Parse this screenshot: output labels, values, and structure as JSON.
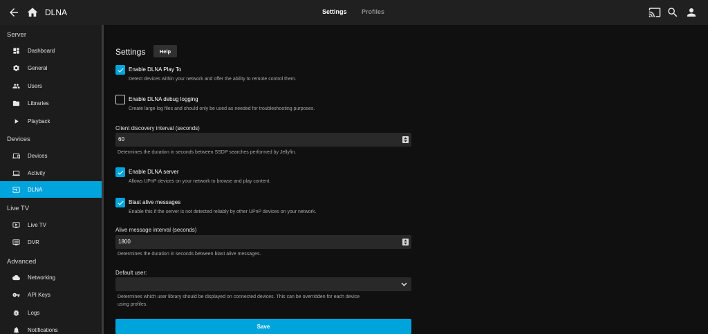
{
  "header": {
    "title": "DLNA",
    "tabs": [
      "Settings",
      "Profiles"
    ],
    "icons": [
      "back-arrow-icon",
      "home-icon",
      "cast-icon",
      "search-icon",
      "user-icon"
    ]
  },
  "sidebar": {
    "sections": [
      {
        "title": "Server",
        "items": [
          {
            "label": "Dashboard",
            "icon": "dashboard-icon"
          },
          {
            "label": "General",
            "icon": "gear-icon"
          },
          {
            "label": "Users",
            "icon": "users-icon"
          },
          {
            "label": "Libraries",
            "icon": "folder-icon"
          },
          {
            "label": "Playback",
            "icon": "play-icon"
          }
        ]
      },
      {
        "title": "Devices",
        "items": [
          {
            "label": "Devices",
            "icon": "devices-icon"
          },
          {
            "label": "Activity",
            "icon": "activity-icon"
          },
          {
            "label": "DLNA",
            "icon": "dlna-icon",
            "active": true
          }
        ]
      },
      {
        "title": "Live TV",
        "items": [
          {
            "label": "Live TV",
            "icon": "tv-icon"
          },
          {
            "label": "DVR",
            "icon": "dvr-icon"
          }
        ]
      },
      {
        "title": "Advanced",
        "items": [
          {
            "label": "Networking",
            "icon": "cloud-icon"
          },
          {
            "label": "API Keys",
            "icon": "key-icon"
          },
          {
            "label": "Logs",
            "icon": "bug-icon"
          },
          {
            "label": "Notifications",
            "icon": "bell-icon"
          }
        ]
      }
    ]
  },
  "main": {
    "title": "Settings",
    "help_label": "Help",
    "play_to": {
      "label": "Enable DLNA Play To",
      "description": "Detect devices within your network and offer the ability to remote control them.",
      "checked": true
    },
    "debug_logging": {
      "label": "Enable DLNA debug logging",
      "description": "Create large log files and should only be used as needed for troubleshooting purposes.",
      "checked": false
    },
    "client_discovery": {
      "label": "Client discovery interval (seconds)",
      "value": "60",
      "description": "Determines the duration in seconds between SSDP searches performed by Jellyfin."
    },
    "dlna_server": {
      "label": "Enable DLNA server",
      "description": "Allows UPnP devices on your network to browse and play content.",
      "checked": true
    },
    "blast_alive": {
      "label": "Blast alive messages",
      "description": "Enable this if the server is not detected reliably by other UPnP devices on your network.",
      "checked": true
    },
    "alive_interval": {
      "label": "Alive message interval (seconds)",
      "value": "1800",
      "description": "Determines the duration in seconds between blast alive messages."
    },
    "default_user": {
      "label": "Default user:",
      "value": "",
      "description_line1": "Determines which user library should be displayed on connected devices. This can be overridden for each device",
      "description_line2": "using profiles."
    },
    "save_label": "Save"
  },
  "colors": {
    "accent": "#00a4dc",
    "background": "#101010",
    "header": "#202020",
    "sidebar": "#1c1c1c",
    "input": "#292929"
  }
}
